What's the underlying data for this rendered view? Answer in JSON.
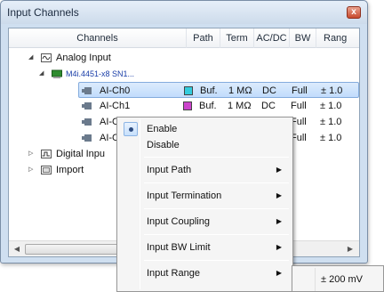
{
  "window": {
    "title": "Input Channels",
    "close_glyph": "x"
  },
  "columns": {
    "channels": "Channels",
    "path": "Path",
    "term": "Term",
    "acdc": "AC/DC",
    "bw": "BW",
    "range": "Rang"
  },
  "tree": {
    "analog": "Analog Input",
    "device": "M4i.4451-x8 SN1...",
    "channels": [
      {
        "name": "AI-Ch0",
        "color": "#33ccdd",
        "path": "Buf.",
        "term": "1 MΩ",
        "acdc": "DC",
        "bw": "Full",
        "range": "± 1.0"
      },
      {
        "name": "AI-Ch1",
        "color": "#cc44cc",
        "path": "Buf.",
        "term": "1 MΩ",
        "acdc": "DC",
        "bw": "Full",
        "range": "± 1.0"
      },
      {
        "name": "AI-C",
        "bw": "Full",
        "range": "± 1.0"
      },
      {
        "name": "AI-C",
        "bw": "Full",
        "range": "± 1.0"
      }
    ],
    "digital": "Digital Inpu",
    "import": "Import"
  },
  "context_menu": {
    "enable": "Enable",
    "disable": "Disable",
    "input_path": "Input Path",
    "input_termination": "Input Termination",
    "input_coupling": "Input Coupling",
    "input_bw_limit": "Input BW Limit",
    "input_range": "Input Range"
  },
  "submenu": {
    "item": "± 200 mV"
  },
  "icons": {
    "expand_open": "◢",
    "expand_closed": "▷",
    "submenu_arrow": "▶",
    "scroll_left": "◀",
    "scroll_right": "▶"
  }
}
